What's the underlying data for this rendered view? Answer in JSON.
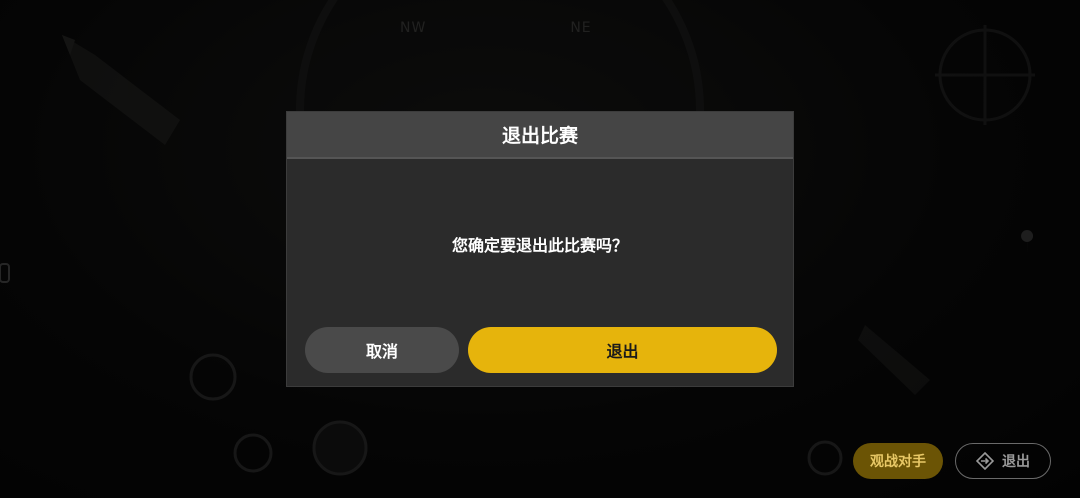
{
  "background": {
    "compass_marks": [
      "NW",
      "NE"
    ]
  },
  "dialog": {
    "title": "退出比赛",
    "message": "您确定要退出此比赛吗？",
    "cancel_label": "取消",
    "confirm_label": "退出"
  },
  "hud": {
    "spectate_label": "观战对手",
    "exit_label": "退出"
  },
  "colors": {
    "accent_yellow": "#e6b40c",
    "dialog_bg": "#2b2b2b",
    "dialog_header": "#454545",
    "cancel_bg": "#4a4a4a"
  }
}
